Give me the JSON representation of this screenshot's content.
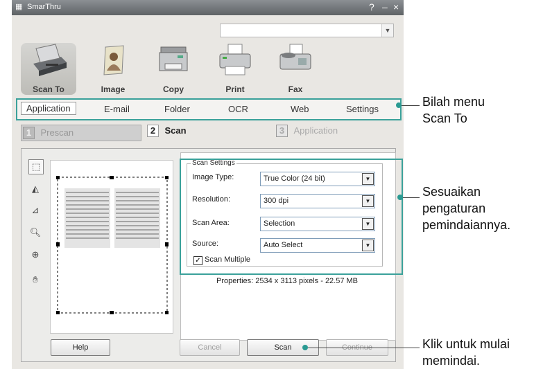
{
  "window": {
    "title": "SmarThru"
  },
  "toolbar": {
    "items": [
      {
        "label": "Scan To",
        "icon": "scanner-icon"
      },
      {
        "label": "Image",
        "icon": "image-icon"
      },
      {
        "label": "Copy",
        "icon": "copier-icon"
      },
      {
        "label": "Print",
        "icon": "printer-icon"
      },
      {
        "label": "Fax",
        "icon": "fax-icon"
      }
    ]
  },
  "menubar": {
    "items": [
      "Application",
      "E-mail",
      "Folder",
      "OCR",
      "Web",
      "Settings"
    ],
    "selected": "Application"
  },
  "steps": [
    {
      "num": "1",
      "label": "Prescan"
    },
    {
      "num": "2",
      "label": "Scan"
    },
    {
      "num": "3",
      "label": "Application"
    }
  ],
  "scan_settings": {
    "group_title": "Scan Settings",
    "image_type": {
      "label": "Image Type:",
      "value": "True Color (24 bit)"
    },
    "resolution": {
      "label": "Resolution:",
      "value": "300 dpi"
    },
    "scan_area": {
      "label": "Scan Area:",
      "value": "Selection"
    },
    "source": {
      "label": "Source:",
      "value": "Auto Select"
    },
    "scan_multiple": {
      "label": "Scan Multiple",
      "checked": true
    },
    "properties": "Properties: 2534 x 3113 pixels - 22.57 MB"
  },
  "buttons": {
    "help": "Help",
    "cancel": "Cancel",
    "scan": "Scan",
    "continue": "Continue"
  },
  "annotations": {
    "menu_1": "Bilah menu",
    "menu_2": "Scan To",
    "adjust_1": "Sesuaikan",
    "adjust_2": "pengaturan",
    "adjust_3": "pemindaiannya.",
    "click_1": "Klik untuk mulai",
    "click_2": "memindai."
  },
  "colors": {
    "highlight": "#3aa19a"
  }
}
